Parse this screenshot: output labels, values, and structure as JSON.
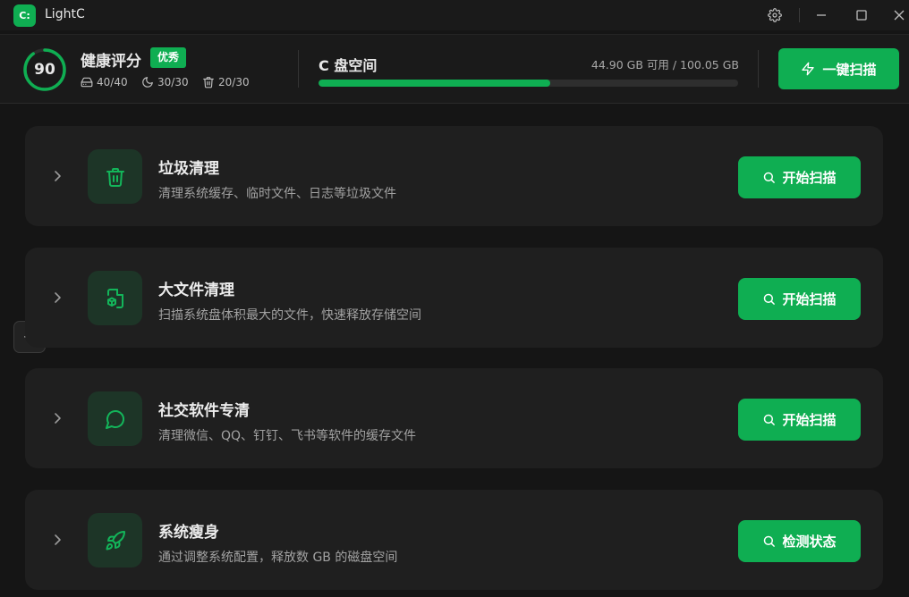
{
  "window": {
    "logo_text": "C:",
    "title": "LightC"
  },
  "header": {
    "score": "90",
    "health_title": "健康评分",
    "health_badge": "优秀",
    "stats": [
      {
        "icon": "drive-icon",
        "value": "40/40"
      },
      {
        "icon": "moon-icon",
        "value": "30/30"
      },
      {
        "icon": "trash-icon",
        "value": "20/30"
      }
    ],
    "disk_title": "C 盘空间",
    "disk_usage": "44.90 GB 可用 / 100.05 GB",
    "disk_used_fraction": 0.5512,
    "scan_all_label": "一键扫描"
  },
  "cards": [
    {
      "title": "垃圾清理",
      "desc": "清理系统缓存、临时文件、日志等垃圾文件",
      "button": "开始扫描",
      "icon": "trash-icon"
    },
    {
      "title": "大文件清理",
      "desc": "扫描系统盘体积最大的文件，快速释放存储空间",
      "button": "开始扫描",
      "icon": "file-box-icon"
    },
    {
      "title": "社交软件专清",
      "desc": "清理微信、QQ、钉钉、飞书等软件的缓存文件",
      "button": "开始扫描",
      "icon": "chat-bubble-icon"
    },
    {
      "title": "系统瘦身",
      "desc": "通过调整系统配置，释放数 GB 的磁盘空间",
      "button": "检测状态",
      "icon": "rocket-icon"
    }
  ],
  "colors": {
    "accent": "#0fae52",
    "background": "#151515",
    "card": "#1f1f1f"
  }
}
